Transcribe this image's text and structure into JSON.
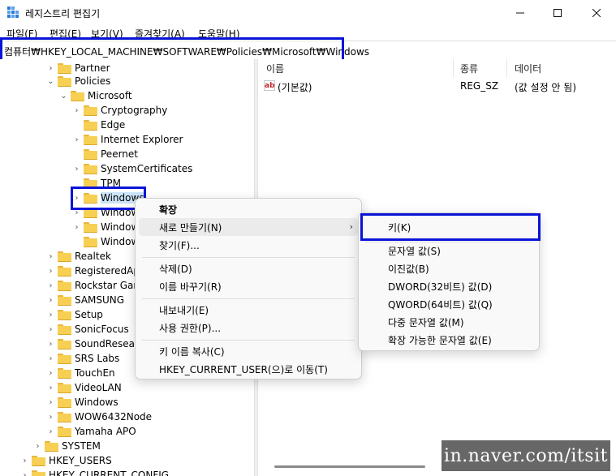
{
  "window": {
    "title": "레지스트리 편집기",
    "minimize_glyph": "—",
    "maximize_glyph": "☐",
    "close_glyph": "✕"
  },
  "menubar": [
    "파일(F)",
    "편집(E)",
    "보기(V)",
    "즐겨찾기(A)",
    "도움말(H)"
  ],
  "address": {
    "path": "컴퓨터₩HKEY_LOCAL_MACHINE₩SOFTWARE₩Policies₩Microsoft₩Windows"
  },
  "tree": [
    {
      "label": "Partner",
      "expander": "›",
      "folder": true
    },
    {
      "label": "Policies",
      "expander": "⌄",
      "folder": true
    },
    {
      "label": "Microsoft",
      "expander": "⌄",
      "folder": true
    },
    {
      "label": "Cryptography",
      "expander": "›",
      "folder": true
    },
    {
      "label": "Edge",
      "expander": "",
      "folder": true
    },
    {
      "label": "Internet Explorer",
      "expander": "›",
      "folder": true
    },
    {
      "label": "Peernet",
      "expander": "",
      "folder": true
    },
    {
      "label": "SystemCertificates",
      "expander": "›",
      "folder": true
    },
    {
      "label": "TPM",
      "expander": "",
      "folder": true
    },
    {
      "label": "Windows",
      "expander": "›",
      "folder": true
    },
    {
      "label": "Window",
      "expander": "›",
      "folder": true
    },
    {
      "label": "Window",
      "expander": "›",
      "folder": true
    },
    {
      "label": "Window",
      "expander": "",
      "folder": true
    },
    {
      "label": "Realtek",
      "expander": "›",
      "folder": true
    },
    {
      "label": "RegisteredApp",
      "expander": "›",
      "folder": true
    },
    {
      "label": "Rockstar Gam",
      "expander": "›",
      "folder": true
    },
    {
      "label": "SAMSUNG",
      "expander": "›",
      "folder": true
    },
    {
      "label": "Setup",
      "expander": "›",
      "folder": true
    },
    {
      "label": "SonicFocus",
      "expander": "›",
      "folder": true
    },
    {
      "label": "SoundResearc",
      "expander": "›",
      "folder": true
    },
    {
      "label": "SRS Labs",
      "expander": "›",
      "folder": true
    },
    {
      "label": "TouchEn",
      "expander": "›",
      "folder": true
    },
    {
      "label": "VideoLAN",
      "expander": "›",
      "folder": true
    },
    {
      "label": "Windows",
      "expander": "›",
      "folder": true
    },
    {
      "label": "WOW6432Node",
      "expander": "›",
      "folder": true
    },
    {
      "label": "Yamaha APO",
      "expander": "›",
      "folder": true
    },
    {
      "label": "SYSTEM",
      "expander": "›",
      "folder": true
    },
    {
      "label": "HKEY_USERS",
      "expander": "›",
      "folder": true
    },
    {
      "label": "HKEY_CURRENT_CONFIG",
      "expander": "›",
      "folder": true
    }
  ],
  "list": {
    "columns": [
      "이름",
      "종류",
      "데이터"
    ],
    "rows": [
      {
        "name": "(기본값)",
        "type": "REG_SZ",
        "data": "(값 설정 안 됨)",
        "icon": "ab"
      }
    ]
  },
  "context_menu": {
    "items": [
      "확장",
      "새로 만들기(N)",
      "찾기(F)...",
      "삭제(D)",
      "이름 바꾸기(R)",
      "내보내기(E)",
      "사용 권한(P)...",
      "키 이름 복사(C)",
      "HKEY_CURRENT_USER(으)로 이동(T)"
    ],
    "submenu_arrow": "›"
  },
  "submenu": {
    "items": [
      "키(K)",
      "문자열 값(S)",
      "이진값(B)",
      "DWORD(32비트) 값(D)",
      "QWORD(64비트) 값(Q)",
      "다중 문자열 값(M)",
      "확장 가능한 문자열 값(E)"
    ]
  },
  "watermark": "in.naver.com/itsit",
  "colors": {
    "highlight_box": "#0a14d8",
    "folder": "#f7cf52",
    "selection": "#cce4f7"
  }
}
